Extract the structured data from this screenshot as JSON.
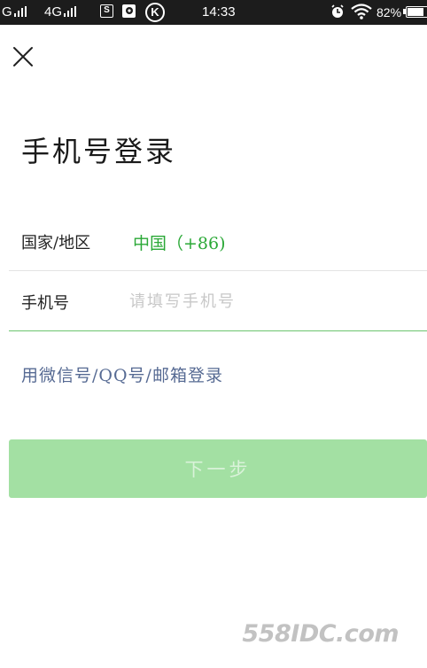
{
  "status_bar": {
    "carrier_text": "G",
    "network_text": "4G",
    "icon_s_label": "S",
    "icon_k_label": "K",
    "time": "14:33",
    "battery_text": "82%",
    "battery_level": 0.82,
    "icons": [
      "signal-icon",
      "signal-icon",
      "sim-s-icon",
      "app-icon",
      "k-icon",
      "alarm-icon",
      "wifi-icon",
      "battery-icon"
    ]
  },
  "close_icon": "close-icon",
  "title": "手机号登录",
  "country_row": {
    "label": "国家/地区",
    "value": "中国（+86)"
  },
  "phone_row": {
    "label": "手机号",
    "value": "",
    "placeholder": "请填写手机号"
  },
  "alt_login_link": "用微信号/QQ号/邮箱登录",
  "next_button": "下一步",
  "colors": {
    "accent_green": "#2aa836",
    "input_underline": "#6cc56f",
    "link_blue": "#566a93",
    "button_disabled": "#a3e0a3"
  },
  "watermark": "558IDC.com"
}
